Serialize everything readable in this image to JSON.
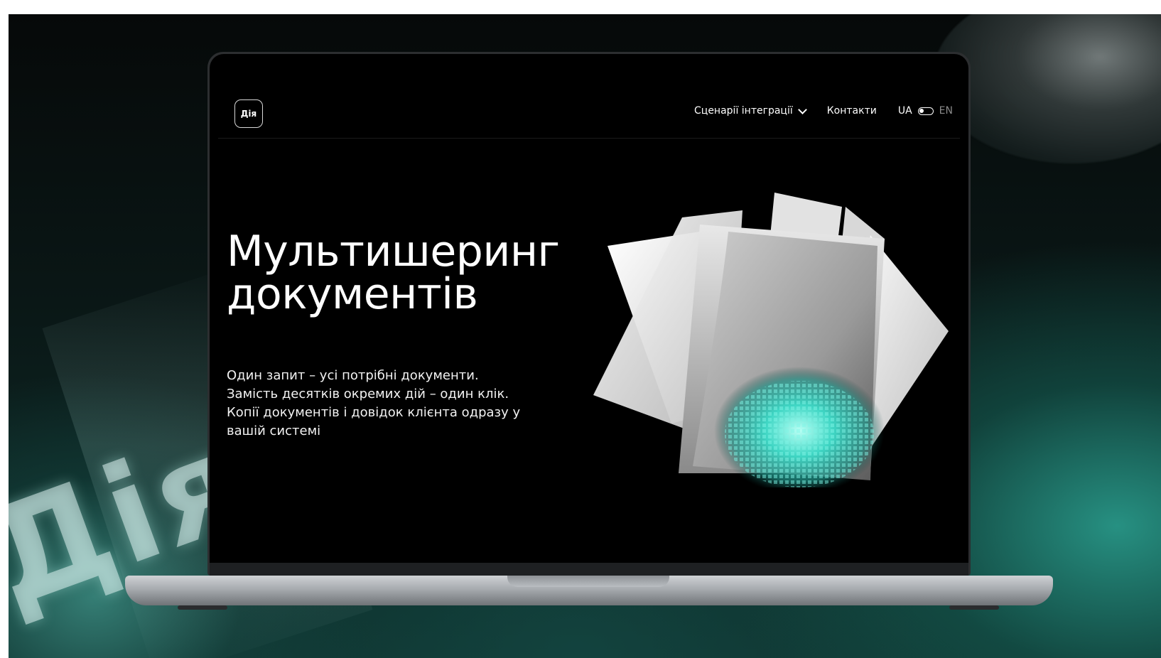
{
  "background": {
    "logo_text": "Дія",
    "accent_color": "#1f9e8d"
  },
  "header": {
    "logo_text": "Дія",
    "nav": {
      "scenarios": "Сценарії інтеграції",
      "contacts": "Контакти"
    },
    "language": {
      "active": "UA",
      "inactive": "EN"
    }
  },
  "hero": {
    "title_line1": "Мультишеринг",
    "title_line2": "документів",
    "description": "Один запит – усі потрібні документи. Замість десятків окремих дій – один клік. Копії документів і довідок клієнта одразу у вашій системі"
  },
  "icons": {
    "dropdown": "chevron-down-icon",
    "toggle": "toggle-icon"
  }
}
